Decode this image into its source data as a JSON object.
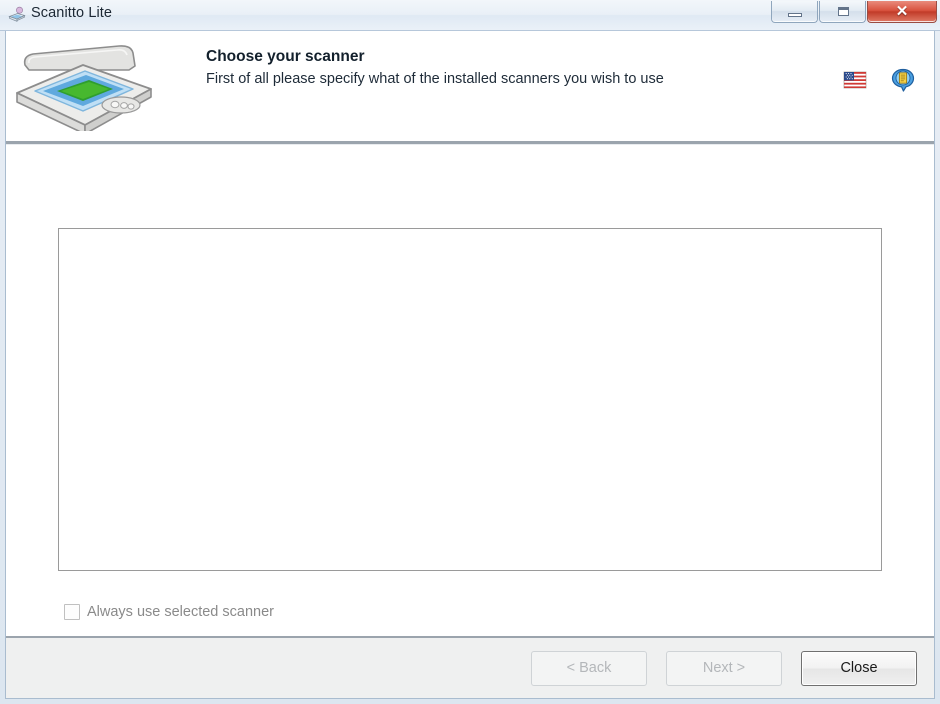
{
  "window": {
    "title": "Scanitto Lite",
    "title_icon": "scanner-icon",
    "controls": {
      "minimize": "Minimize",
      "maximize": "Maximize",
      "close": "✕"
    }
  },
  "header": {
    "icon": "flatbed-scanner-icon",
    "title": "Choose your scanner",
    "subtitle": "First of all please specify what of the installed scanners you wish to use",
    "language_icon": "us-flag-icon",
    "help_icon": "globe-help-icon"
  },
  "main": {
    "scanner_list": {
      "name": "scanner-list",
      "items": [],
      "empty": ""
    },
    "always_use_checkbox": {
      "label": "Always use selected scanner",
      "checked": false,
      "disabled": true
    }
  },
  "footer": {
    "buttons": [
      {
        "label": "< Back",
        "name": "back-button",
        "state": "disabled"
      },
      {
        "label": "Next >",
        "name": "next-button",
        "state": "disabled"
      },
      {
        "label": "Close",
        "name": "close-button",
        "state": "enabled"
      }
    ]
  },
  "colors": {
    "accent": "#3f7fbf",
    "close_red": "#d9533f",
    "frame": "#a9bccf",
    "footer_bg": "#eff0f0",
    "separator": "#9ba4ad"
  }
}
